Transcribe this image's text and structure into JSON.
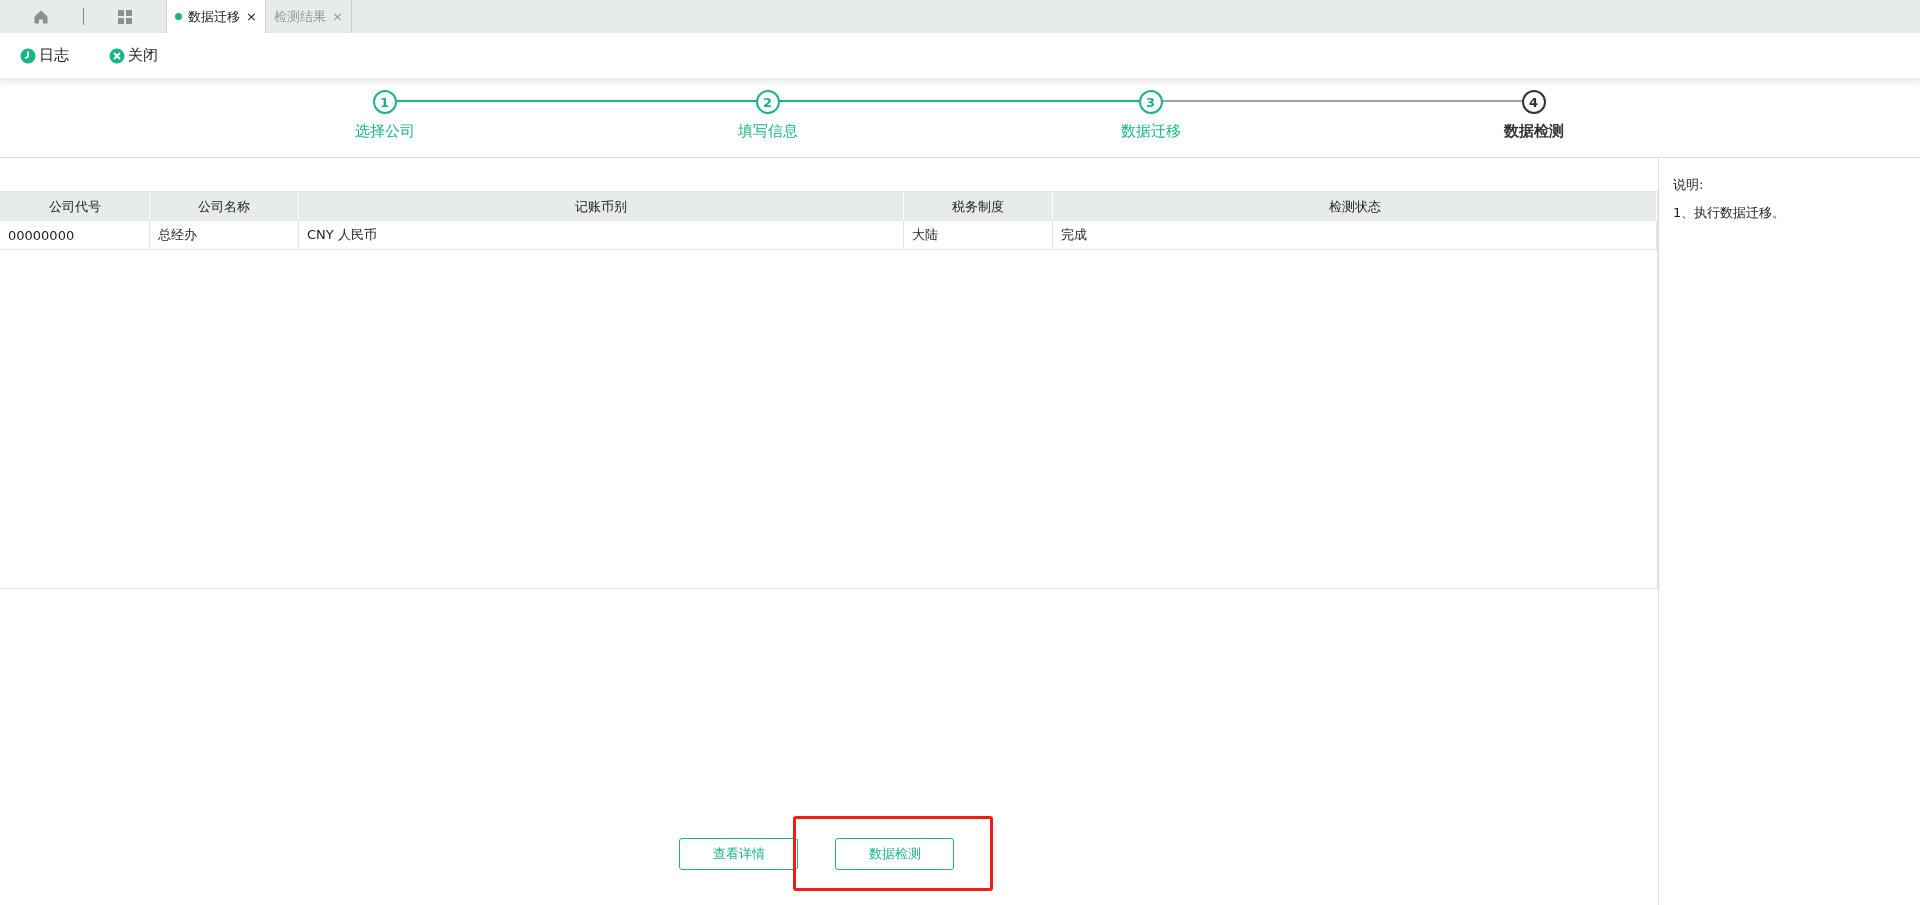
{
  "tabs": [
    {
      "label": "数据迁移",
      "selected": true,
      "close": "×"
    },
    {
      "label": "检测结果",
      "selected": false,
      "close": "×"
    }
  ],
  "toolbar": [
    {
      "label": "日志",
      "kind": "log"
    },
    {
      "label": "关闭",
      "kind": "close"
    }
  ],
  "steps": [
    {
      "number": "1",
      "label": "选择公司",
      "done": true
    },
    {
      "number": "2",
      "label": "填写信息",
      "done": true
    },
    {
      "number": "3",
      "label": "数据迁移",
      "done": true
    },
    {
      "number": "4",
      "label": "数据检测",
      "done": false
    }
  ],
  "table": {
    "columns": [
      "公司代号",
      "公司名称",
      "记账币别",
      "税务制度",
      "检测状态"
    ],
    "rows": [
      [
        "00000000",
        "总经办",
        "CNY 人民币",
        "大陆",
        "完成"
      ]
    ]
  },
  "notes": {
    "title": "说明:",
    "lines": [
      "1、执行数据迁移。"
    ]
  },
  "buttons": [
    {
      "label": "查看详情",
      "highlighted": false
    },
    {
      "label": "数据检测",
      "highlighted": true
    }
  ]
}
